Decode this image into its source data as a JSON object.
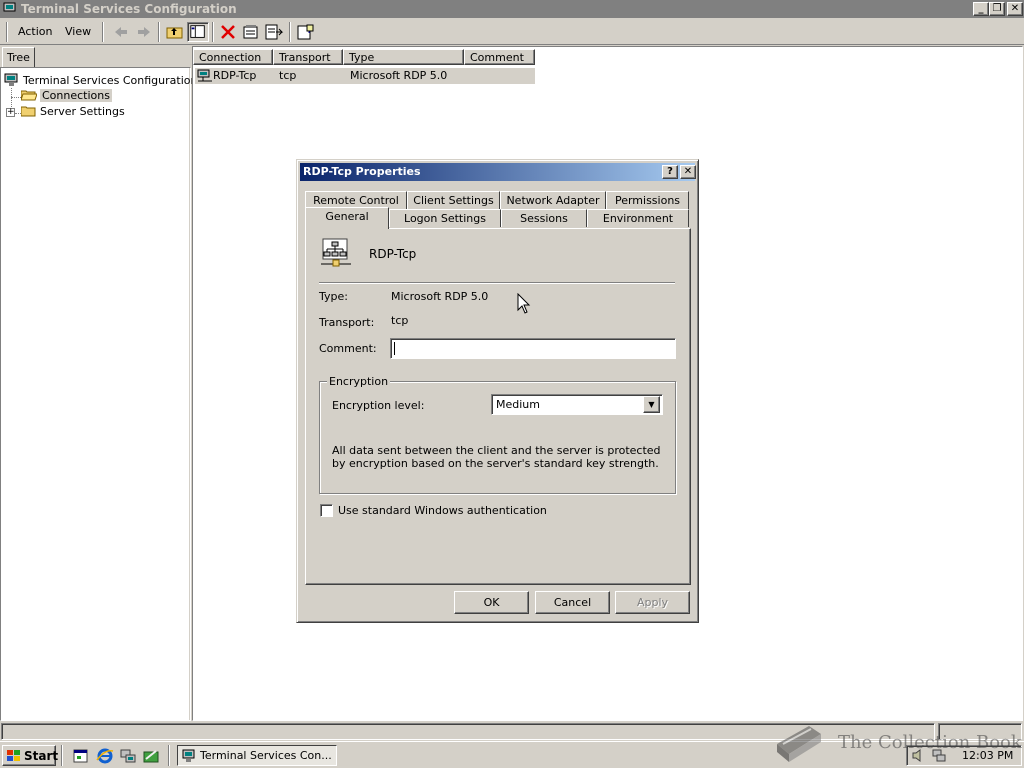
{
  "window": {
    "title": "Terminal Services Configuration"
  },
  "menu": {
    "action": "Action",
    "view": "View"
  },
  "tree": {
    "tab_label": "Tree",
    "root": "Terminal Services Configuration",
    "items": [
      {
        "label": "Connections"
      },
      {
        "label": "Server Settings"
      }
    ]
  },
  "list": {
    "columns": [
      "Connection",
      "Transport",
      "Type",
      "Comment"
    ],
    "rows": [
      {
        "connection": "RDP-Tcp",
        "transport": "tcp",
        "type": "Microsoft RDP 5.0",
        "comment": ""
      }
    ]
  },
  "dialog": {
    "title": "RDP-Tcp Properties",
    "tabs_back": [
      "Remote Control",
      "Client Settings",
      "Network Adapter",
      "Permissions"
    ],
    "tabs_front": [
      "General",
      "Logon Settings",
      "Sessions",
      "Environment"
    ],
    "active_tab": "General",
    "connection_name": "RDP-Tcp",
    "type_label": "Type:",
    "type_value": "Microsoft RDP 5.0",
    "transport_label": "Transport:",
    "transport_value": "tcp",
    "comment_label": "Comment:",
    "comment_value": "",
    "encryption": {
      "group_label": "Encryption",
      "level_label": "Encryption level:",
      "level_value": "Medium",
      "description": "All data sent between the client and the server is protected by encryption based on the server's standard key strength."
    },
    "auth_checkbox_label": "Use standard Windows authentication",
    "auth_checked": false,
    "buttons": {
      "ok": "OK",
      "cancel": "Cancel",
      "apply": "Apply"
    }
  },
  "taskbar": {
    "start": "Start",
    "task": "Terminal Services Con...",
    "clock": "12:03 PM"
  },
  "watermark": "The Collection Book",
  "colors": {
    "title_active": "#0a246a",
    "title_gradient_end": "#a6caf0",
    "title_inactive": "#808080",
    "face": "#d4d0c8"
  }
}
